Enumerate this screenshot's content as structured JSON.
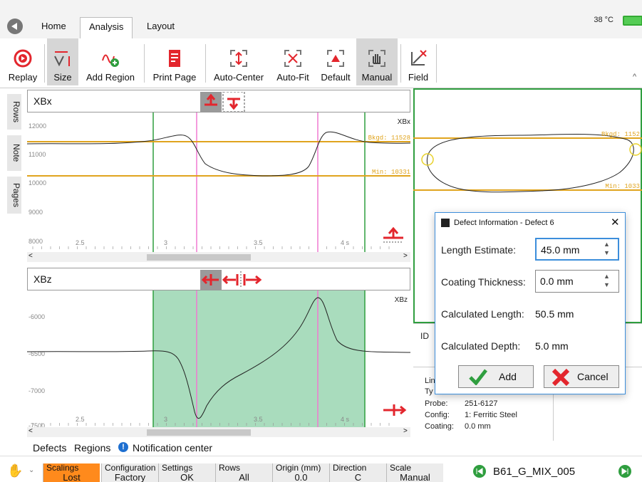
{
  "tabs": [
    "Home",
    "Analysis",
    "Layout"
  ],
  "active_tab": "Analysis",
  "temperature": "38 °C",
  "ribbon": {
    "replay": "Replay",
    "size": "Size",
    "add_region": "Add Region",
    "print_page": "Print Page",
    "auto_center": "Auto-Center",
    "auto_fit": "Auto-Fit",
    "default": "Default",
    "manual": "Manual",
    "field": "Field"
  },
  "side_tabs": [
    "Rows",
    "Note",
    "Pages"
  ],
  "panel_top": {
    "title": "XBx",
    "corner_label": "XBx",
    "y_ticks": [
      "12000",
      "11000",
      "10000",
      "9000",
      "8000"
    ],
    "x_ticks": [
      "2.5",
      "3",
      "3.5",
      "4 s"
    ],
    "bkgd_label": "Bkgd: 11528",
    "min_label": "Min: 10331"
  },
  "panel_bottom": {
    "title": "XBz",
    "corner_label": "XBz",
    "y_ticks": [
      "-6000",
      "-6500",
      "-7000",
      "-7500"
    ],
    "x_ticks": [
      "2.5",
      "3",
      "3.5",
      "4 s"
    ]
  },
  "side_chart": {
    "bkgd_label": "Bkgd: 1152",
    "min_label": "Min: 1033"
  },
  "dialog": {
    "title": "Defect Information - Defect 6",
    "length_label": "Length Estimate:",
    "length_value": "45.0 mm",
    "coating_label": "Coating Thickness:",
    "coating_value": "0.0 mm",
    "calc_length_label": "Calculated Length:",
    "calc_length_value": "50.5 mm",
    "calc_depth_label": "Calculated Depth:",
    "calc_depth_value": "5.0 mm",
    "add": "Add",
    "cancel": "Cancel"
  },
  "info_panel": {
    "id_label": "ID",
    "lin_partial": "Lin",
    "ty_partial": "Ty",
    "probe_label": "Probe:",
    "probe_value": "251-6127",
    "config_label": "Config:",
    "config_value": "1: Ferritic Steel",
    "coating_label": "Coating:",
    "coating_value": "0.0 mm"
  },
  "bottom_tabs": [
    "Defects",
    "Regions",
    "Notification center"
  ],
  "status": [
    {
      "label": "Scalings",
      "value": "Lost"
    },
    {
      "label": "Configuration",
      "value": "Factory"
    },
    {
      "label": "Settings",
      "value": "OK"
    },
    {
      "label": "Rows",
      "value": "All"
    },
    {
      "label": "Origin (mm)",
      "value": "0.0"
    },
    {
      "label": "Direction",
      "value": "C"
    },
    {
      "label": "Scale",
      "value": "Manual"
    }
  ],
  "filename": "B61_G_MIX_005",
  "colors": {
    "accent_red": "#e3262d",
    "level_line": "#e0a41e",
    "marker_green": "#2f9e3f",
    "marker_pink": "#f07ad2",
    "region_fill": "#a9dcbd",
    "status_orange": "#ff8a1c"
  }
}
